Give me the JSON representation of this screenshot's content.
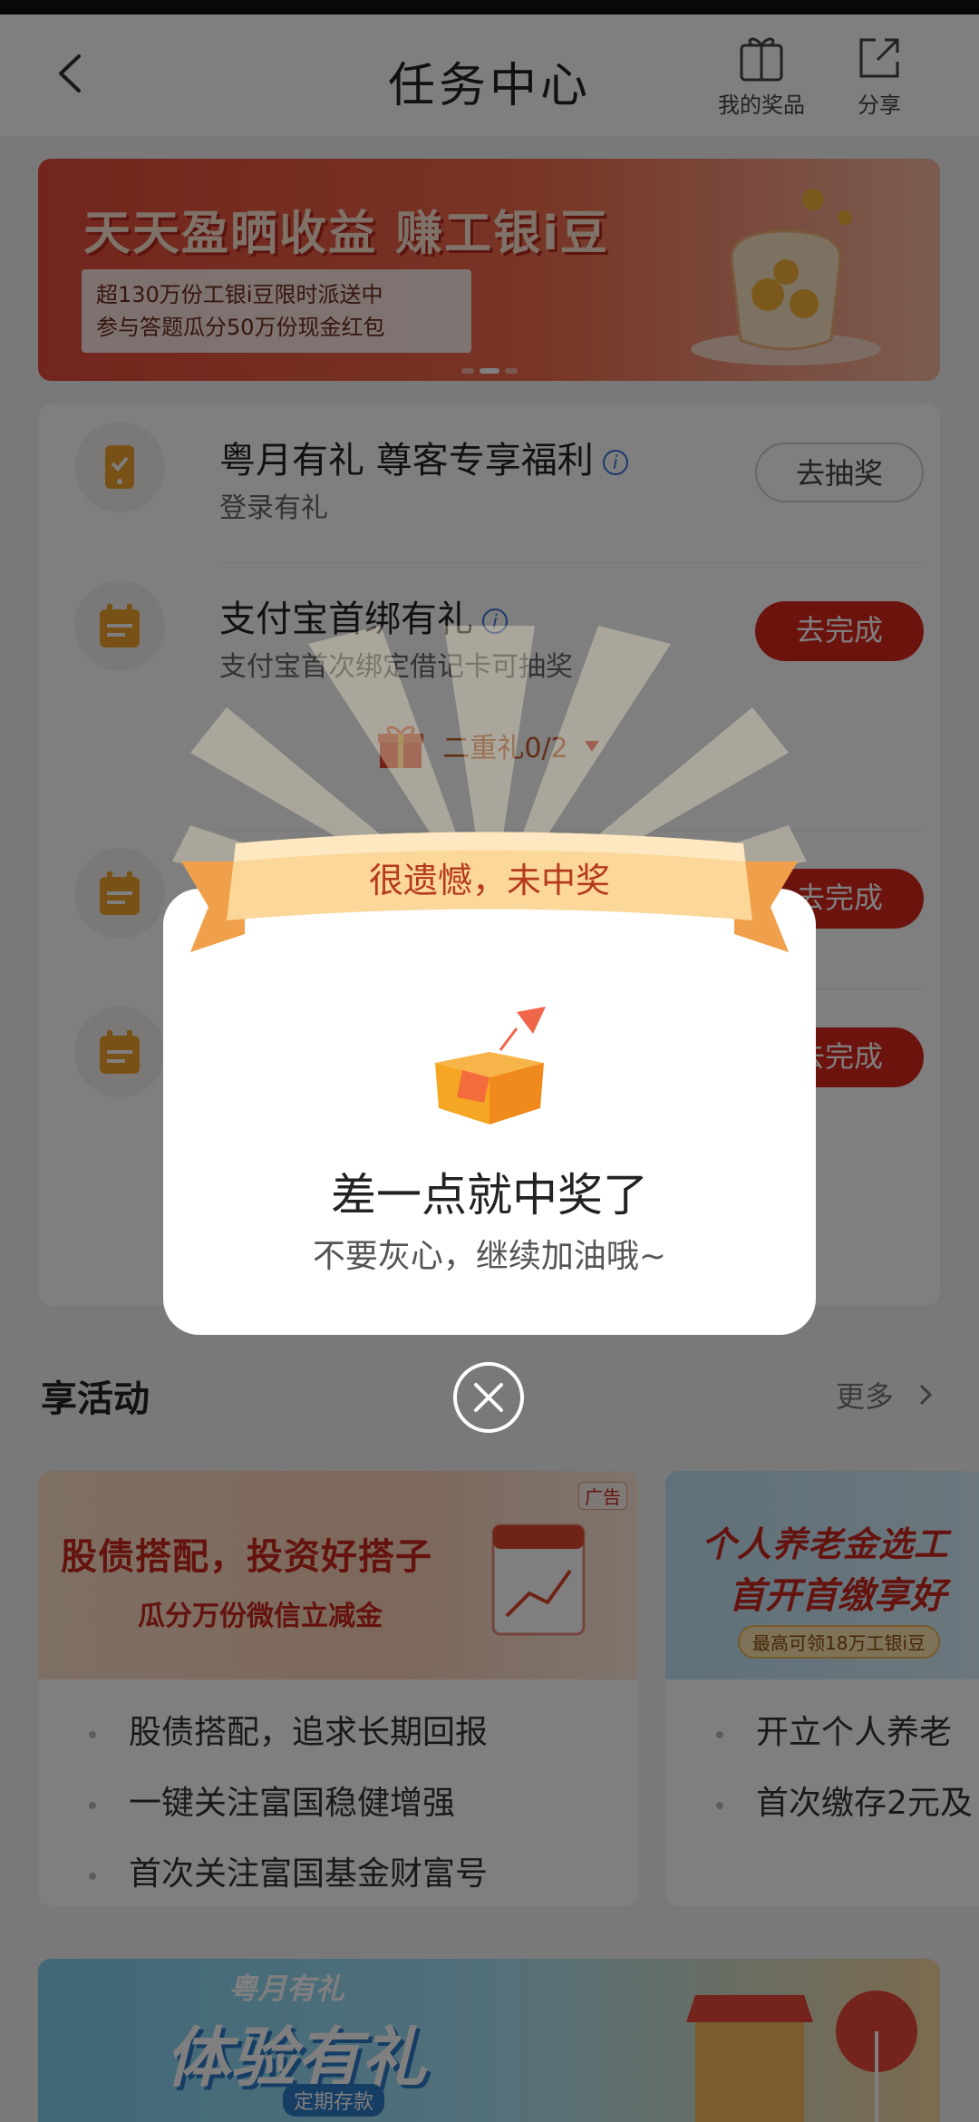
{
  "header": {
    "title": "任务中心",
    "prize_label": "我的奖品",
    "share_label": "分享"
  },
  "banner": {
    "title": "天天盈晒收益 赚工银i豆",
    "line1": "超130万份工银i豆限时派送中",
    "line2": "参与答题瓜分50万份现金红包"
  },
  "tasks": [
    {
      "title": "粤月有礼 尊客专享福利",
      "desc": "登录有礼",
      "button": "去抽奖"
    },
    {
      "title": "支付宝首绑有礼",
      "desc": "支付宝首次绑定借记卡可抽奖",
      "button": "去完成"
    },
    {
      "title": "",
      "desc": "",
      "button": "去完成"
    },
    {
      "title": "",
      "desc": "",
      "button": "去完成"
    }
  ],
  "gift_progress": "二重礼0/2",
  "activities": {
    "title": "享活动",
    "more": "更多",
    "cards": [
      {
        "headline": "股债搭配，投资好搭子",
        "subline": "瓜分万份微信立减金",
        "ad_tag": "广告",
        "items": [
          "股债搭配，追求长期回报",
          "一键关注富国稳健增强",
          "首次关注富国基金财富号"
        ]
      },
      {
        "headline": "个人养老金选工",
        "subline": "首开首缴享好",
        "badge": "最高可领18万工银i豆",
        "items": [
          "开立个人养老",
          "首次缴存2元及"
        ]
      }
    ]
  },
  "bottom_banner": {
    "small": "粤月有礼",
    "big": "体验有礼",
    "tag": "定期存款"
  },
  "modal": {
    "ribbon": "很遗憾，未中奖",
    "title": "差一点就中奖了",
    "subtitle": "不要灰心，继续加油哦~"
  },
  "colors": {
    "brand_red": "#d9261c",
    "ribbon_orange": "#f5b25a",
    "mask": "rgba(0,0,0,0.5)"
  }
}
